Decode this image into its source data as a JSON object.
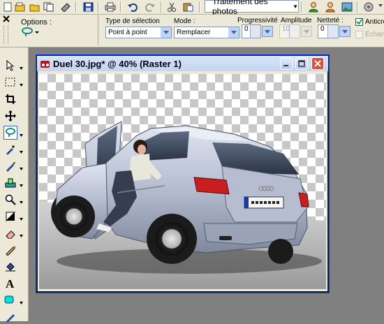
{
  "toolbar": {
    "photo_menu_label": "Traitement des photos",
    "photo_menu_icon": "dropdown-caret-icon"
  },
  "options": {
    "options_label": "Options :",
    "selection_type_label": "Type de sélection",
    "selection_type_value": "Point à point",
    "mode_label": "Mode :",
    "mode_value": "Remplacer",
    "progressivity_label": "Progressivité",
    "progressivity_value": "0",
    "amplitude_label": "Amplitude",
    "amplitude_value": "10",
    "sharpness_label": "Netteté :",
    "sharpness_value": "0",
    "antialias_label": "Anticré",
    "antialias_checked": true,
    "sample_label": "Échant"
  },
  "image_window": {
    "title": "Duel 30.jpg* @  40% (Raster 1)"
  },
  "colors": {
    "toolbar_bg": "#ece9d8",
    "workspace_bg": "#808080",
    "close_red": "#d9513b",
    "title_bg": "#c3d3f3"
  }
}
